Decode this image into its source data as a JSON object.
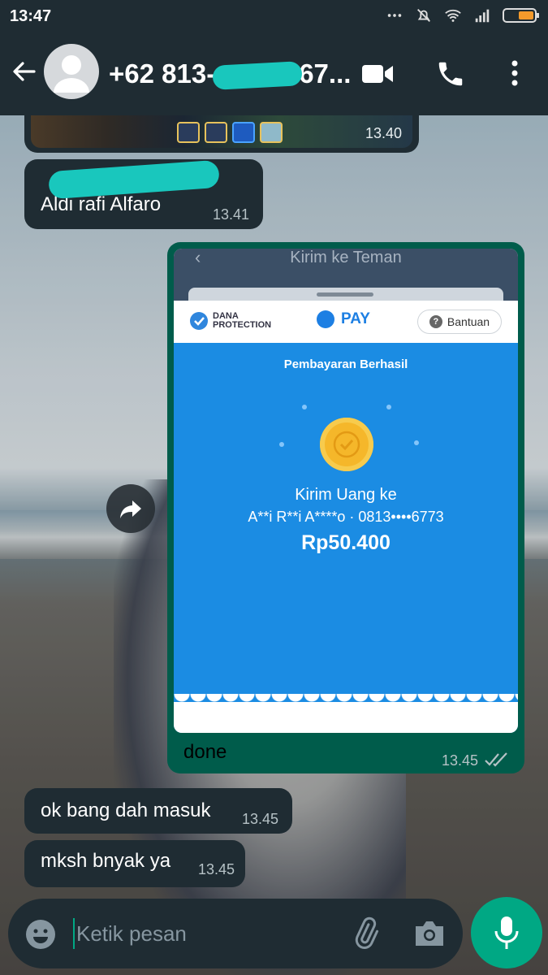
{
  "status_bar": {
    "time": "13:47",
    "icons": [
      "alarm-icon",
      "mute-icon",
      "wifi-icon",
      "signal-icon",
      "battery-icon"
    ]
  },
  "header": {
    "contact_name": "+62 813-",
    "contact_name_end": "-67...",
    "icons": [
      "back-icon",
      "video-call-icon",
      "phone-icon",
      "more-icon"
    ]
  },
  "messages": [
    {
      "direction": "in",
      "type": "image",
      "time": "13.40"
    },
    {
      "direction": "in",
      "type": "text",
      "text": "Aldi rafi Alfaro",
      "time": "13.41"
    },
    {
      "direction": "out",
      "type": "image",
      "caption": "done",
      "time": "13.45",
      "status": "read",
      "screenshot": {
        "top_title": "Kirim ke Teman",
        "brand": "DANA",
        "brand_sub": "PROTECTION",
        "pay_label": "PAY",
        "help_label": "Bantuan",
        "status_title": "Pembayaran Berhasil",
        "send_label": "Kirim Uang ke",
        "recipient": "A**i R**i A****o · 0813••••6773",
        "amount": "Rp50.400"
      }
    },
    {
      "direction": "in",
      "type": "text",
      "text": "ok bang dah masuk",
      "time": "13.45"
    },
    {
      "direction": "in",
      "type": "text",
      "text": "mksh bnyak ya",
      "time": "13.45"
    }
  ],
  "composer": {
    "placeholder": "Ketik pesan"
  },
  "colors": {
    "bar": "#1f2c33",
    "outgoing": "#005c4b",
    "accent": "#00a884",
    "dana_blue": "#1b8ce3"
  }
}
